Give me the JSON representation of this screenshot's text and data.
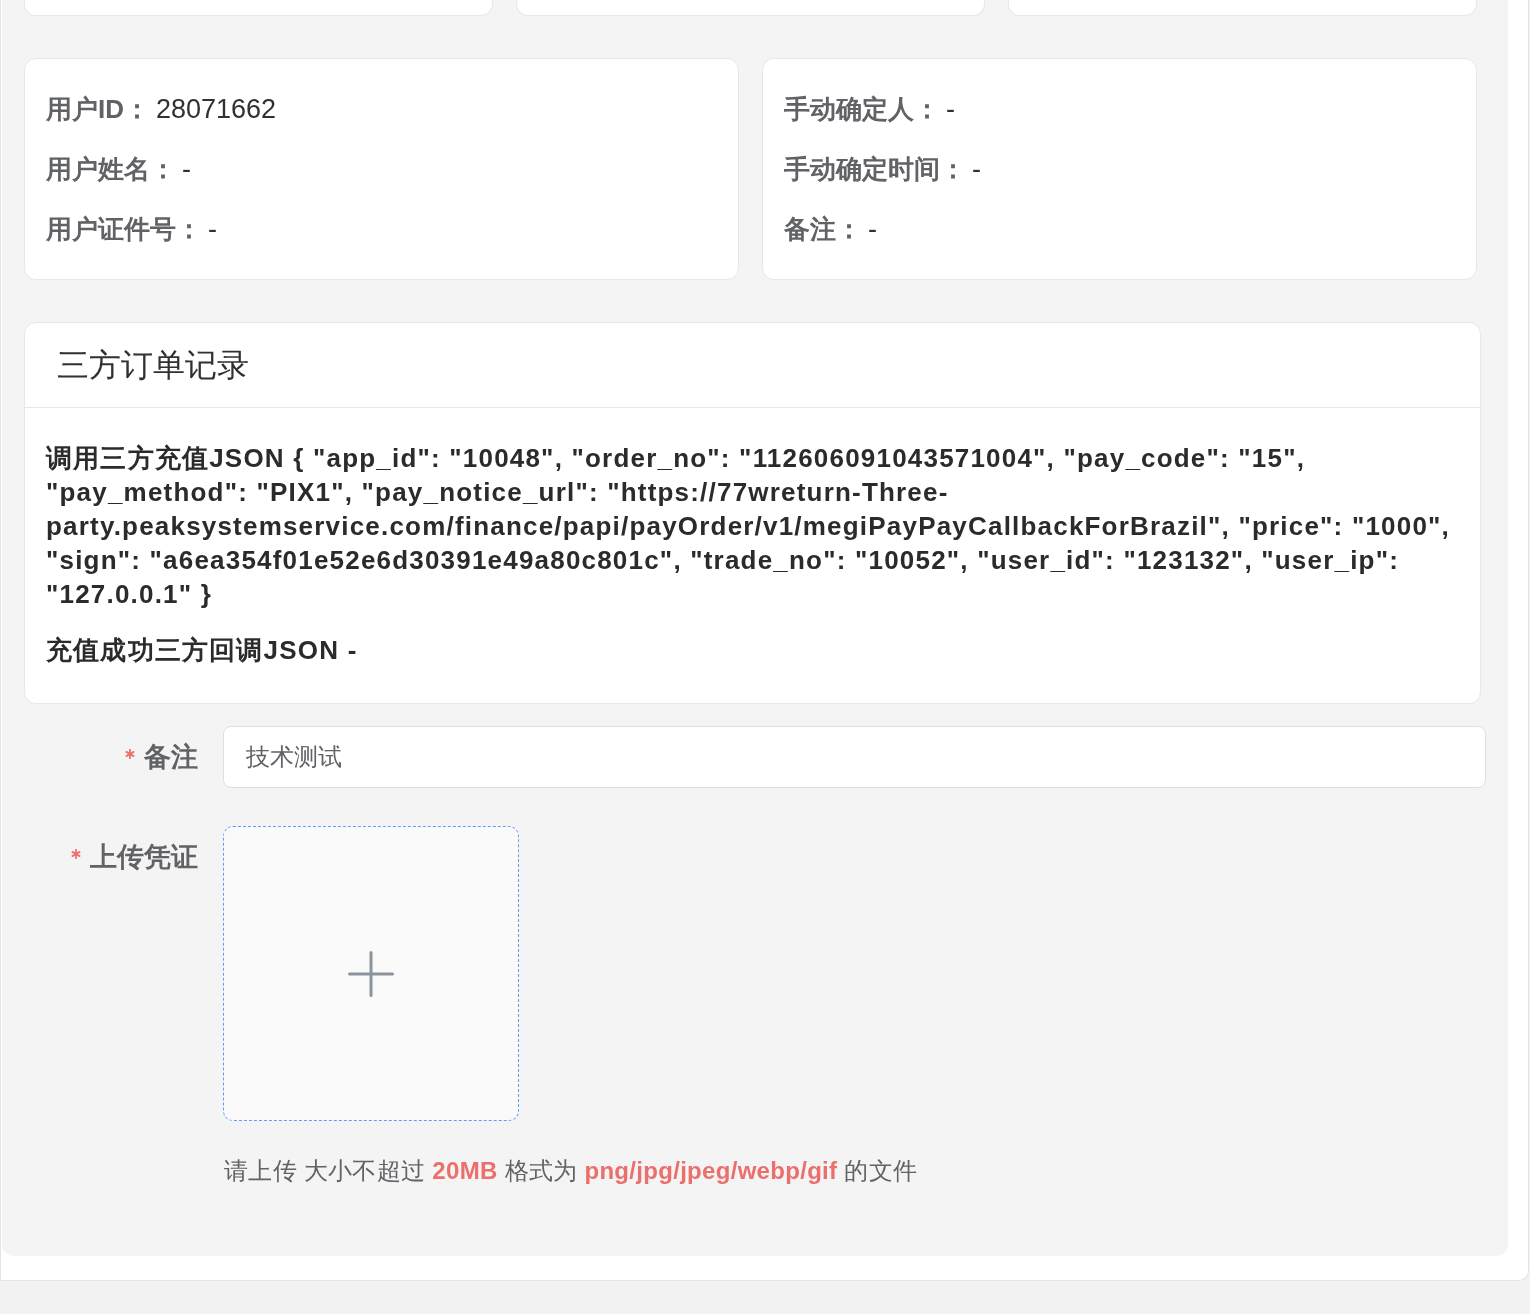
{
  "info_cards": [
    {
      "rows": [
        "**用户ID：**28071662",
        "**用户姓名：**-",
        "**用户证件号：**-"
      ]
    },
    {
      "rows": [
        "**手动确定人：**-",
        "**手动确定时间：**-",
        "**备注：**-"
      ]
    }
  ],
  "third_party_record": {
    "title": "三方订单记录",
    "entries": [
      "调用三方充值JSON { \"app_id\": \"10048\", \"order_no\": \"112606091043571004\", \"pay_code\": \"15\", \"pay_method\": \"PIX1\", \"pay_notice_url\": \"https://77wreturn-Three-party.peaksystemservice.com/finance/papi/payOrder/v1/megiPayPayCallbackForBrazil\", \"price\": \"1000\", \"sign\": \"a6ea354f01e52e6d30391e49a80c801c\", \"trade_no\": \"10052\", \"user_id\": \"123132\", \"user_ip\": \"127.0.0.1\" }",
      "充值成功三方回调JSON -"
    ]
  },
  "form": {
    "fields": [
      {
        "kind": "input",
        "label": "备注",
        "required": true,
        "value": "技术测试"
      },
      {
        "kind": "upload",
        "label": "上传凭证",
        "required": true
      }
    ],
    "upload_hint": "请上传 大小不超过 **20MB** 格式为 **png/jpg/jpeg/webp/gif** 的文件"
  }
}
